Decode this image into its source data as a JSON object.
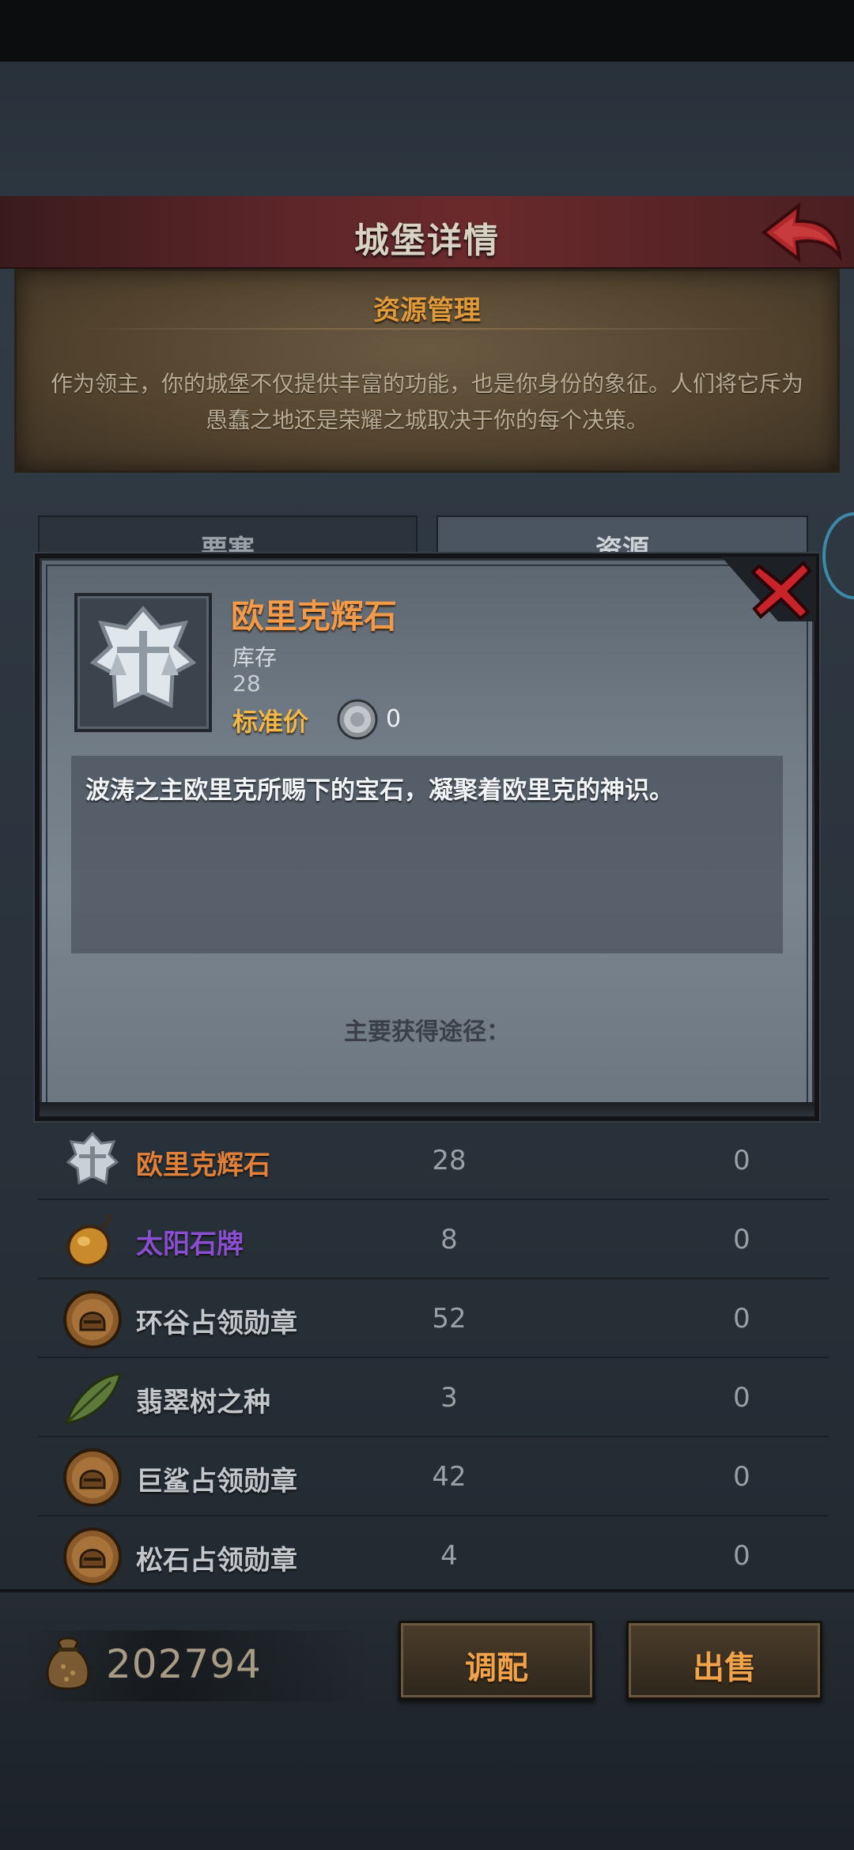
{
  "header": {
    "title": "城堡详情"
  },
  "info_panel": {
    "title": "资源管理",
    "text": "作为领主，你的城堡不仅提供丰富的功能，也是你身份的象征。人们将它斥为愚蠢之地还是荣耀之城取决于你的每个决策。"
  },
  "tabs": [
    {
      "label": "要塞"
    },
    {
      "label": "资源"
    }
  ],
  "popup": {
    "item_name": "欧里克辉石",
    "stock_label": "库存",
    "stock_value": "28",
    "price_label": "标准价",
    "price_value": "0",
    "description": "波涛之主欧里克所赐下的宝石，凝聚着欧里克的神识。",
    "source_label": "主要获得途径："
  },
  "resources": [
    {
      "name": "欧里克辉石",
      "count": "28",
      "price": "0",
      "name_color": "#e0803a",
      "icon": "silver-scale-gem-icon"
    },
    {
      "name": "太阳石牌",
      "count": "8",
      "price": "0",
      "name_color": "#8a4fd0",
      "icon": "amber-pendant-icon"
    },
    {
      "name": "环谷占领勋章",
      "count": "52",
      "price": "0",
      "name_color": "#c3c7cb",
      "icon": "helmet-medal-icon"
    },
    {
      "name": "翡翠树之种",
      "count": "3",
      "price": "0",
      "name_color": "#c3c7cb",
      "icon": "leaf-seed-icon"
    },
    {
      "name": "巨鲨占领勋章",
      "count": "42",
      "price": "0",
      "name_color": "#c3c7cb",
      "icon": "helmet-medal-icon"
    },
    {
      "name": "松石占领勋章",
      "count": "4",
      "price": "0",
      "name_color": "#c3c7cb",
      "icon": "helmet-medal-icon"
    }
  ],
  "bottom": {
    "gold": "202794",
    "adjust_label": "调配",
    "sell_label": "出售"
  },
  "colors": {
    "accent_orange": "#f09a4a",
    "header_red": "#6a2a2c",
    "epic_purple": "#8a4fd0"
  }
}
